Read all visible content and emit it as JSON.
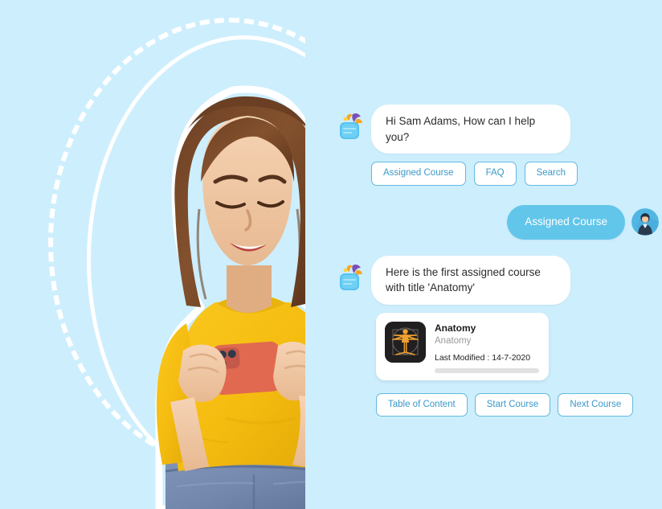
{
  "theme": {
    "background": "#cdeefd",
    "bot_bubble_bg": "#ffffff",
    "user_bubble_bg": "#62c6ea",
    "chip_border": "#63b9dd",
    "chip_text": "#3a99c9",
    "card_thumb_bg": "#211f1f",
    "card_thumb_accent": "#f0a030",
    "sweater_color": "#f6bf14",
    "phone_color": "#e0694f",
    "jeans_color": "#7d92b5"
  },
  "hero": {
    "alt": "Smiling young woman in a yellow sweater using a smartphone",
    "ring_decoration": "dashed-circle"
  },
  "chat": {
    "messages": [
      {
        "id": "bot-greeting",
        "sender": "bot",
        "avatar_icon": "chatbot-icon",
        "text": "Hi Sam Adams, How can I help you?"
      },
      {
        "id": "user-assigned-course",
        "sender": "user",
        "avatar_icon": "user-avatar-icon",
        "text": "Assigned Course"
      },
      {
        "id": "bot-first-course",
        "sender": "bot",
        "avatar_icon": "chatbot-icon",
        "text": "Here is the first assigned course with title 'Anatomy'"
      }
    ],
    "quick_replies_top": [
      {
        "id": "assigned-course",
        "label": "Assigned Course"
      },
      {
        "id": "faq",
        "label": "FAQ"
      },
      {
        "id": "search",
        "label": "Search"
      }
    ],
    "quick_replies_bottom": [
      {
        "id": "table-of-content",
        "label": "Table of Content"
      },
      {
        "id": "start-course",
        "label": "Start Course"
      },
      {
        "id": "next-course",
        "label": "Next Course"
      }
    ],
    "course_card": {
      "thumbnail_icon": "vitruvian-man-icon",
      "title": "Anatomy",
      "subtitle": "Anatomy",
      "last_modified_label": "Last Modified : 14-7-2020",
      "progress_percent": 0
    }
  }
}
